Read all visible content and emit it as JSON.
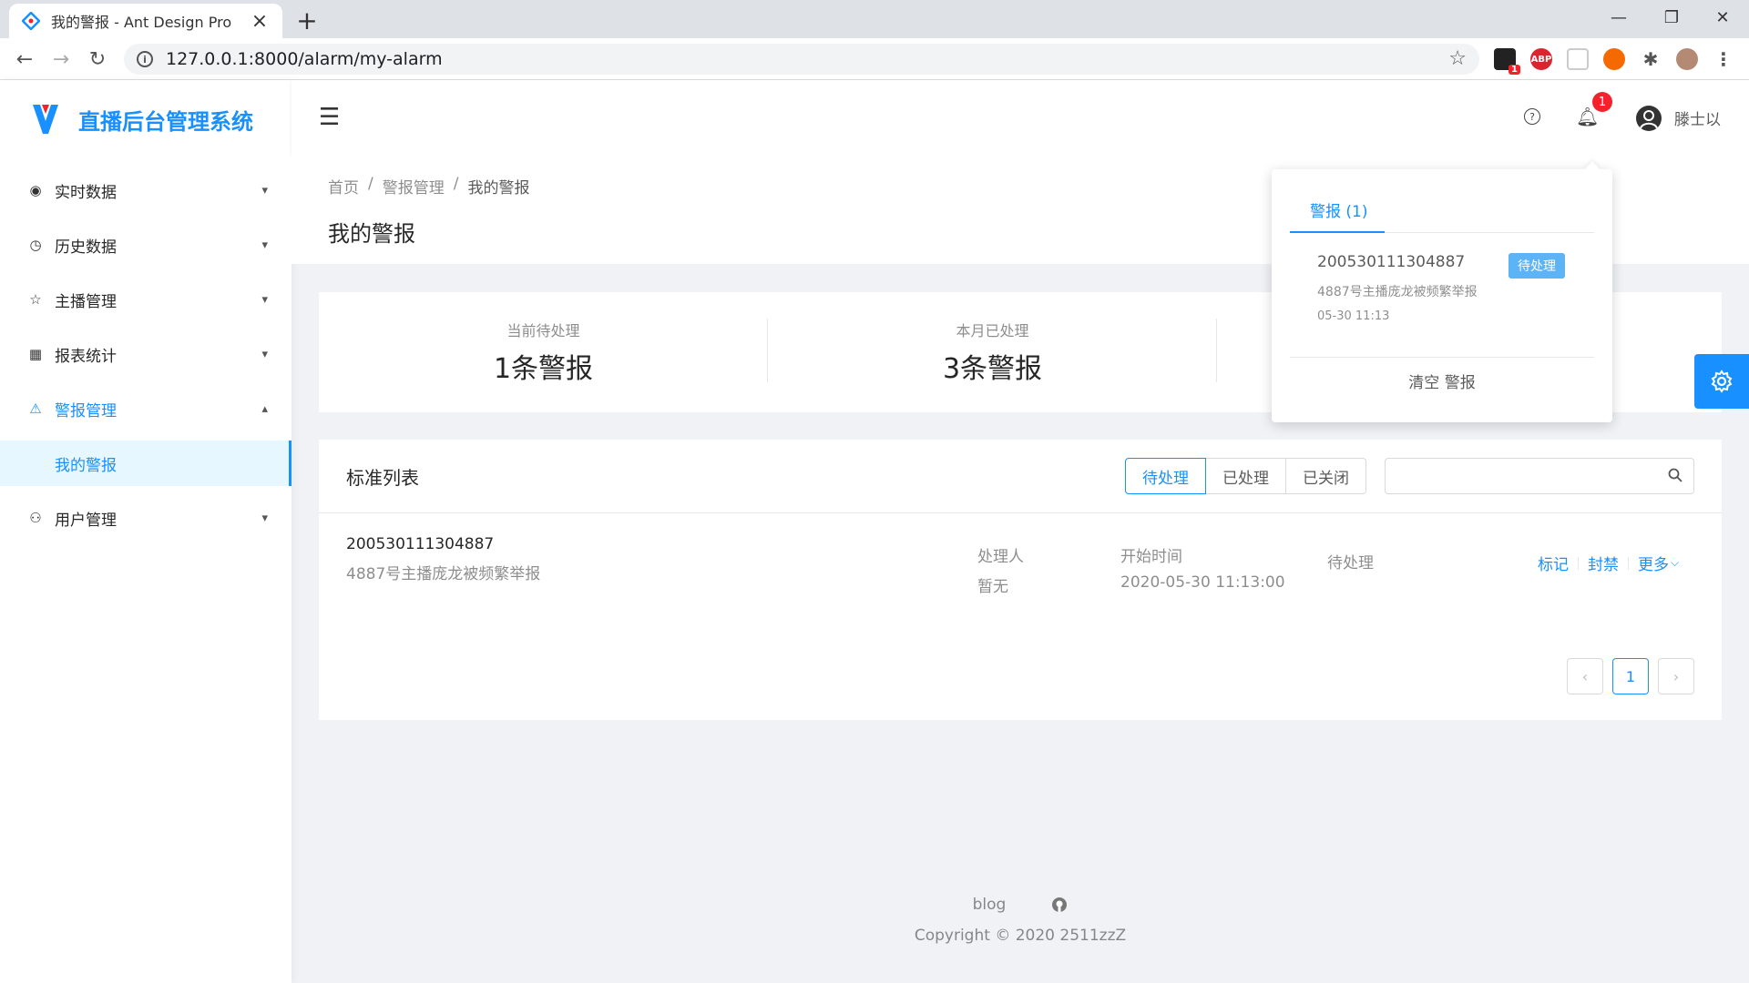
{
  "browser": {
    "tab_title": "我的警报 - Ant Design Pro",
    "url": "127.0.0.1:8000/alarm/my-alarm",
    "ext_abp": "ABP",
    "ext_badge": "1"
  },
  "sidebar": {
    "app_name": "直播后台管理系统",
    "items": [
      {
        "label": "实时数据",
        "icon": "eye-scan-icon"
      },
      {
        "label": "历史数据",
        "icon": "history-icon"
      },
      {
        "label": "主播管理",
        "icon": "star-icon"
      },
      {
        "label": "报表统计",
        "icon": "table-icon"
      },
      {
        "label": "警报管理",
        "icon": "warning-icon"
      },
      {
        "label": "用户管理",
        "icon": "user-icon"
      }
    ],
    "sub_active": "我的警报"
  },
  "header": {
    "notice_count": "1",
    "username": "滕士以"
  },
  "breadcrumb": [
    "首页",
    "/",
    "警报管理",
    "/",
    "我的警报"
  ],
  "page_title": "我的警报",
  "stats": [
    {
      "label": "当前待处理",
      "value": "1条警报"
    },
    {
      "label": "本月已处理",
      "value": "3条警报"
    }
  ],
  "list": {
    "title": "标准列表",
    "filters": [
      "待处理",
      "已处理",
      "已关闭"
    ],
    "active_filter": "待处理",
    "search_placeholder": "",
    "rows": [
      {
        "id": "200530111304887",
        "desc": "4887号主播庞龙被频繁举报",
        "handler_label": "处理人",
        "handler_value": "暂无",
        "start_label": "开始时间",
        "start_value": "2020-05-30 11:13:00",
        "status": "待处理",
        "actions": [
          "标记",
          "封禁",
          "更多"
        ]
      }
    ],
    "pagination": {
      "current": "1"
    }
  },
  "footer": {
    "link": "blog",
    "copyright": "Copyright © 2020 2511zzZ"
  },
  "notice_popover": {
    "tab": "警报 (1)",
    "item_id": "200530111304887",
    "item_tag": "待处理",
    "item_desc": "4887号主播庞龙被频繁举报",
    "item_time": "05-30 11:13",
    "clear": "清空 警报"
  },
  "colors": {
    "primary": "#1890ff",
    "badge": "#f5222d",
    "tag": "#5cb3f6"
  }
}
